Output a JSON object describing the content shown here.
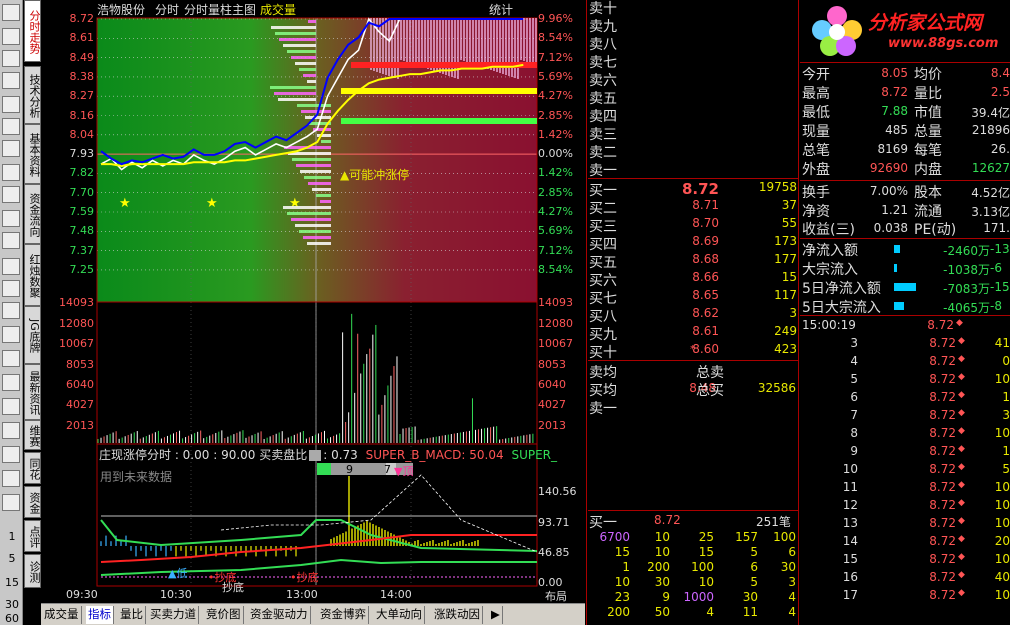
{
  "header": {
    "stock": "浩物股份",
    "tab_intraday": "分时",
    "tab_volume": "分时量柱主图",
    "tab_turnover": "成交量",
    "stats_btn": "统计"
  },
  "left_tabs": [
    "分时走势",
    "技术分析",
    "基本资料",
    "资金流向",
    "红烛数聚",
    "JG底牌",
    "最新资讯",
    "维赛",
    "同花",
    "资金",
    "点评",
    "诊测"
  ],
  "left_numbers": [
    "1",
    "5",
    "15",
    "30",
    "60"
  ],
  "price_axis": {
    "left": [
      "8.72",
      "8.61",
      "8.49",
      "8.38",
      "8.27",
      "8.16",
      "8.04",
      "7.93",
      "7.82",
      "7.70",
      "7.59",
      "7.48",
      "7.37",
      "7.25"
    ],
    "right": [
      "9.96%",
      "8.54%",
      "7.12%",
      "5.69%",
      "4.27%",
      "2.85%",
      "1.42%",
      "0.00%",
      "1.42%",
      "2.85%",
      "4.27%",
      "5.69%",
      "7.12%",
      "8.54%"
    ]
  },
  "volume_axis": [
    "14093",
    "12080",
    "10067",
    "8053",
    "6040",
    "4027",
    "2013"
  ],
  "indicator_axis": [
    "140.56",
    "93.71",
    "46.85",
    "0.00"
  ],
  "time_axis": [
    "09:30",
    "10:30",
    "13:00",
    "14:00"
  ],
  "annotation_top": "▲可能冲涨停",
  "indicator": {
    "title": "庄现涨停分时 : 0.00 : 90.00 买卖盘比",
    "value2": ": 0.73",
    "macd": "SUPER_B_MACD: 50.04",
    "super": "SUPER_",
    "future_label": "用到未来数据",
    "mark_a": "9",
    "mark_b": "7",
    "mark_top": "▼顶",
    "mark_low": "▲低",
    "mark_bottom1": "•抄底",
    "mark_bottom2": "•抄底",
    "mark_bottom3": "抄底"
  },
  "bottom_tabs": [
    "成交量",
    "指标",
    "量比",
    "买卖力道",
    "竞价图",
    "资金驱动力",
    "资金博弈",
    "大单动向",
    "涨跌动因",
    "布局"
  ],
  "bottom_tab_more": "▶",
  "sell_levels": [
    "卖十",
    "卖九",
    "卖八",
    "卖七",
    "卖六",
    "卖五",
    "卖四",
    "卖三",
    "卖二",
    "卖一"
  ],
  "buy_levels": [
    {
      "label": "买一",
      "price": "8.72",
      "vol": "19758"
    },
    {
      "label": "买二",
      "price": "8.71",
      "vol": "37"
    },
    {
      "label": "买三",
      "price": "8.70",
      "vol": "55"
    },
    {
      "label": "买四",
      "price": "8.69",
      "vol": "173"
    },
    {
      "label": "买五",
      "price": "8.68",
      "vol": "177"
    },
    {
      "label": "买六",
      "price": "8.66",
      "vol": "15"
    },
    {
      "label": "买七",
      "price": "8.65",
      "vol": "117"
    },
    {
      "label": "买八",
      "price": "8.62",
      "vol": "3"
    },
    {
      "label": "买九",
      "price": "8.61",
      "vol": "249"
    },
    {
      "label": "买十",
      "price": "8.60",
      "vol": "423"
    }
  ],
  "book_summary": {
    "sell_avg": "卖均",
    "buy_avg": "买均",
    "buy_avg_val": "8.48",
    "total_sell": "总卖",
    "total_buy": "总买",
    "total_buy_val": "32586",
    "sell_one": "卖一"
  },
  "queue": {
    "label": "买一",
    "price": "8.72",
    "count": "251笔",
    "rows": [
      [
        "6700",
        "10",
        "25",
        "157",
        "100"
      ],
      [
        "15",
        "10",
        "15",
        "5",
        "6"
      ],
      [
        "1",
        "200",
        "100",
        "6",
        "30"
      ],
      [
        "10",
        "30",
        "10",
        "5",
        "3"
      ],
      [
        "23",
        "9",
        "1000",
        "30",
        "4"
      ],
      [
        "200",
        "50",
        "4",
        "11",
        "4"
      ]
    ]
  },
  "logo": {
    "title": "分析家公式网",
    "url": "www.88gs.com"
  },
  "stats": [
    {
      "k1": "今开",
      "v1": "8.05",
      "k2": "均价",
      "v2": "8.4"
    },
    {
      "k1": "最高",
      "v1": "8.72",
      "k2": "量比",
      "v2": "2.5"
    },
    {
      "k1": "最低",
      "v1": "7.88",
      "k2": "市值",
      "v2": "39.4亿"
    },
    {
      "k1": "现量",
      "v1": "485",
      "k2": "总量",
      "v2": "21896"
    },
    {
      "k1": "总笔",
      "v1": "8169",
      "k2": "每笔",
      "v2": "26."
    },
    {
      "k1": "外盘",
      "v1": "92690",
      "k2": "内盘",
      "v2": "12627"
    },
    {
      "k1": "换手",
      "v1": "7.00%",
      "k2": "股本",
      "v2": "4.52亿"
    },
    {
      "k1": "净资",
      "v1": "1.21",
      "k2": "流通",
      "v2": "3.13亿"
    },
    {
      "k1": "收益(三)",
      "v1": "0.038",
      "k2": "PE(动)",
      "v2": "171."
    }
  ],
  "flows": [
    {
      "label": "净流入额",
      "value": "-2460万",
      "extra": "-13"
    },
    {
      "label": "大宗流入",
      "value": "-1038万",
      "extra": "-6"
    },
    {
      "label": "5日净流入额",
      "value": "-7083万",
      "extra": "-15"
    },
    {
      "label": "5日大宗流入",
      "value": "-4065万",
      "extra": "-8"
    }
  ],
  "ticks_header": {
    "time": "15:00:19",
    "price": "8.72",
    "arrow": "◆"
  },
  "ticks": [
    {
      "n": "3",
      "p": "8.72",
      "q": "41"
    },
    {
      "n": "4",
      "p": "8.72",
      "q": "0"
    },
    {
      "n": "5",
      "p": "8.72",
      "q": "10"
    },
    {
      "n": "6",
      "p": "8.72",
      "q": "1"
    },
    {
      "n": "7",
      "p": "8.72",
      "q": "3"
    },
    {
      "n": "8",
      "p": "8.72",
      "q": "10"
    },
    {
      "n": "9",
      "p": "8.72",
      "q": "1"
    },
    {
      "n": "10",
      "p": "8.72",
      "q": "5"
    },
    {
      "n": "11",
      "p": "8.72",
      "q": "10"
    },
    {
      "n": "12",
      "p": "8.72",
      "q": "10"
    },
    {
      "n": "13",
      "p": "8.72",
      "q": "10"
    },
    {
      "n": "14",
      "p": "8.72",
      "q": "20"
    },
    {
      "n": "15",
      "p": "8.72",
      "q": "10"
    },
    {
      "n": "16",
      "p": "8.72",
      "q": "40"
    },
    {
      "n": "17",
      "p": "8.72",
      "q": "10"
    }
  ],
  "colors": {
    "up": "#ff5555",
    "down": "#33dd55",
    "volume": "#e8e800",
    "price_line": "#ffffff",
    "avg_line": "#ffff00"
  }
}
